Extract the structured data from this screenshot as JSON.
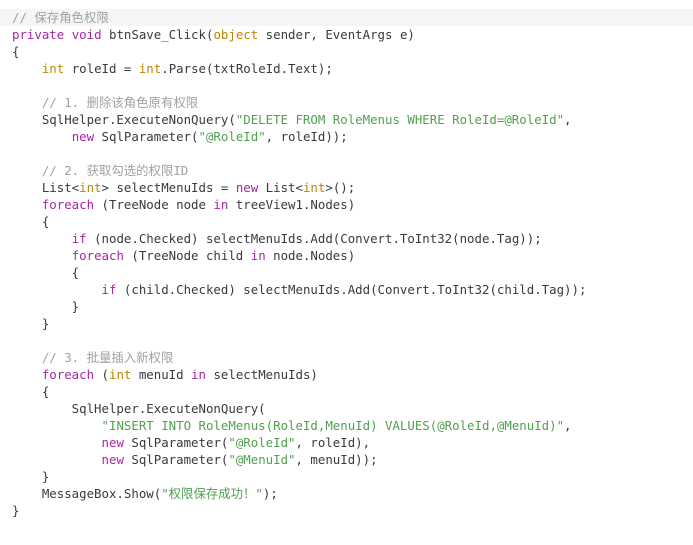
{
  "editor": {
    "language": "csharp",
    "theme": {
      "background": "#ffffff",
      "first_line_background": "#f5f5f5",
      "plain": "#383a42",
      "keyword": "#a626a4",
      "type": "#c18401",
      "string": "#50a14f",
      "comment": "#a0a1a7"
    },
    "lines": [
      [
        {
          "t": "// 保存角色权限",
          "c": "cm"
        }
      ],
      [
        {
          "t": "private",
          "c": "kw"
        },
        {
          "t": " ",
          "c": "pl"
        },
        {
          "t": "void",
          "c": "kw"
        },
        {
          "t": " btnSave_Click(",
          "c": "pl"
        },
        {
          "t": "object",
          "c": "type"
        },
        {
          "t": " sender, EventArgs e)",
          "c": "pl"
        }
      ],
      [
        {
          "t": "{",
          "c": "pl"
        }
      ],
      [
        {
          "t": "    ",
          "c": "pl"
        },
        {
          "t": "int",
          "c": "type"
        },
        {
          "t": " roleId = ",
          "c": "pl"
        },
        {
          "t": "int",
          "c": "type"
        },
        {
          "t": ".Parse(txtRoleId.Text);",
          "c": "pl"
        }
      ],
      [],
      [
        {
          "t": "    ",
          "c": "pl"
        },
        {
          "t": "// 1. 删除该角色原有权限",
          "c": "cm"
        }
      ],
      [
        {
          "t": "    SqlHelper.ExecuteNonQuery(",
          "c": "pl"
        },
        {
          "t": "\"DELETE FROM RoleMenus WHERE RoleId=@RoleId\"",
          "c": "str"
        },
        {
          "t": ",",
          "c": "pl"
        }
      ],
      [
        {
          "t": "        ",
          "c": "pl"
        },
        {
          "t": "new",
          "c": "kw"
        },
        {
          "t": " SqlParameter(",
          "c": "pl"
        },
        {
          "t": "\"@RoleId\"",
          "c": "str"
        },
        {
          "t": ", roleId));",
          "c": "pl"
        }
      ],
      [],
      [
        {
          "t": "    ",
          "c": "pl"
        },
        {
          "t": "// 2. 获取勾选的权限ID",
          "c": "cm"
        }
      ],
      [
        {
          "t": "    List<",
          "c": "pl"
        },
        {
          "t": "int",
          "c": "type"
        },
        {
          "t": "> selectMenuIds = ",
          "c": "pl"
        },
        {
          "t": "new",
          "c": "kw"
        },
        {
          "t": " List<",
          "c": "pl"
        },
        {
          "t": "int",
          "c": "type"
        },
        {
          "t": ">();",
          "c": "pl"
        }
      ],
      [
        {
          "t": "    ",
          "c": "pl"
        },
        {
          "t": "foreach",
          "c": "kw"
        },
        {
          "t": " (TreeNode node ",
          "c": "pl"
        },
        {
          "t": "in",
          "c": "kw"
        },
        {
          "t": " treeView1.Nodes)",
          "c": "pl"
        }
      ],
      [
        {
          "t": "    {",
          "c": "pl"
        }
      ],
      [
        {
          "t": "        ",
          "c": "pl"
        },
        {
          "t": "if",
          "c": "kw"
        },
        {
          "t": " (node.Checked) selectMenuIds.Add(Convert.ToInt32(node.Tag));",
          "c": "pl"
        }
      ],
      [
        {
          "t": "        ",
          "c": "pl"
        },
        {
          "t": "foreach",
          "c": "kw"
        },
        {
          "t": " (TreeNode child ",
          "c": "pl"
        },
        {
          "t": "in",
          "c": "kw"
        },
        {
          "t": " node.Nodes)",
          "c": "pl"
        }
      ],
      [
        {
          "t": "        {",
          "c": "pl"
        }
      ],
      [
        {
          "t": "            ",
          "c": "pl"
        },
        {
          "t": "if",
          "c": "kw"
        },
        {
          "t": " (child.Checked) selectMenuIds.Add(Convert.ToInt32(child.Tag));",
          "c": "pl"
        }
      ],
      [
        {
          "t": "        }",
          "c": "pl"
        }
      ],
      [
        {
          "t": "    }",
          "c": "pl"
        }
      ],
      [],
      [
        {
          "t": "    ",
          "c": "pl"
        },
        {
          "t": "// 3. 批量插入新权限",
          "c": "cm"
        }
      ],
      [
        {
          "t": "    ",
          "c": "pl"
        },
        {
          "t": "foreach",
          "c": "kw"
        },
        {
          "t": " (",
          "c": "pl"
        },
        {
          "t": "int",
          "c": "type"
        },
        {
          "t": " menuId ",
          "c": "pl"
        },
        {
          "t": "in",
          "c": "kw"
        },
        {
          "t": " selectMenuIds)",
          "c": "pl"
        }
      ],
      [
        {
          "t": "    {",
          "c": "pl"
        }
      ],
      [
        {
          "t": "        SqlHelper.ExecuteNonQuery(",
          "c": "pl"
        }
      ],
      [
        {
          "t": "            ",
          "c": "pl"
        },
        {
          "t": "\"INSERT INTO RoleMenus(RoleId,MenuId) VALUES(@RoleId,@MenuId)\"",
          "c": "str"
        },
        {
          "t": ",",
          "c": "pl"
        }
      ],
      [
        {
          "t": "            ",
          "c": "pl"
        },
        {
          "t": "new",
          "c": "kw"
        },
        {
          "t": " SqlParameter(",
          "c": "pl"
        },
        {
          "t": "\"@RoleId\"",
          "c": "str"
        },
        {
          "t": ", roleId),",
          "c": "pl"
        }
      ],
      [
        {
          "t": "            ",
          "c": "pl"
        },
        {
          "t": "new",
          "c": "kw"
        },
        {
          "t": " SqlParameter(",
          "c": "pl"
        },
        {
          "t": "\"@MenuId\"",
          "c": "str"
        },
        {
          "t": ", menuId));",
          "c": "pl"
        }
      ],
      [
        {
          "t": "    }",
          "c": "pl"
        }
      ],
      [
        {
          "t": "    MessageBox.Show(",
          "c": "pl"
        },
        {
          "t": "\"权限保存成功！\"",
          "c": "str"
        },
        {
          "t": ");",
          "c": "pl"
        }
      ],
      [
        {
          "t": "}",
          "c": "pl"
        }
      ]
    ]
  }
}
